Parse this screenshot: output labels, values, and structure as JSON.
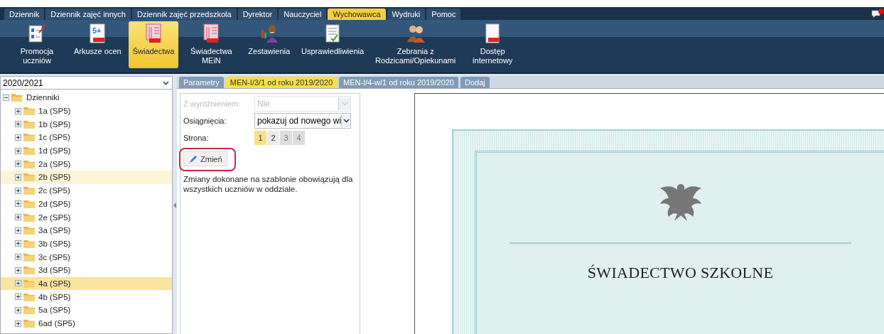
{
  "menu_tabs": [
    {
      "label": "Dziennik",
      "selected": false
    },
    {
      "label": "Dziennik zajęć innych",
      "selected": false
    },
    {
      "label": "Dziennik zajęć przedszkola",
      "selected": false
    },
    {
      "label": "Dyrektor",
      "selected": false
    },
    {
      "label": "Nauczyciel",
      "selected": false
    },
    {
      "label": "Wychowawca",
      "selected": true
    },
    {
      "label": "Wydruki",
      "selected": false
    },
    {
      "label": "Pomoc",
      "selected": false
    }
  ],
  "toolbar": [
    {
      "kind": "promotion",
      "label": "Promocja uczniów",
      "selected": false
    },
    {
      "kind": "pdf-grade",
      "label": "Arkusze ocen",
      "selected": false,
      "badge": "5+"
    },
    {
      "kind": "pdf-book",
      "label": "Świadectwa",
      "selected": true
    },
    {
      "kind": "pdf-book",
      "label": "Świadectwa MEiN",
      "selected": false
    },
    {
      "kind": "chart-person",
      "label": "Zestawienia",
      "selected": false
    },
    {
      "kind": "check-doc",
      "label": "Usprawiedliwienia",
      "selected": false
    },
    {
      "kind": "people",
      "label": "Zebrania z Rodzicami/Opiekunami",
      "selected": false
    },
    {
      "kind": "pdf-blank",
      "label": "Dostęp internetowy",
      "selected": false
    }
  ],
  "year_select": {
    "value": "2020/2021"
  },
  "tree": {
    "label": "Dzienniki",
    "expanded": true,
    "children": [
      {
        "label": "1a (SP5)",
        "selected": false,
        "hovered": false
      },
      {
        "label": "1b (SP5)",
        "selected": false,
        "hovered": false
      },
      {
        "label": "1c (SP5)",
        "selected": false,
        "hovered": false
      },
      {
        "label": "1d (SP5)",
        "selected": false,
        "hovered": false
      },
      {
        "label": "2a (SP5)",
        "selected": false,
        "hovered": false
      },
      {
        "label": "2b (SP5)",
        "selected": false,
        "hovered": true
      },
      {
        "label": "2c (SP5)",
        "selected": false,
        "hovered": false
      },
      {
        "label": "2d (SP5)",
        "selected": false,
        "hovered": false
      },
      {
        "label": "2e (SP5)",
        "selected": false,
        "hovered": false
      },
      {
        "label": "3a (SP5)",
        "selected": false,
        "hovered": false
      },
      {
        "label": "3b (SP5)",
        "selected": false,
        "hovered": false
      },
      {
        "label": "3c (SP5)",
        "selected": false,
        "hovered": false
      },
      {
        "label": "3d (SP5)",
        "selected": false,
        "hovered": false
      },
      {
        "label": "4a (SP5)",
        "selected": true,
        "hovered": false
      },
      {
        "label": "4b (SP5)",
        "selected": false,
        "hovered": false
      },
      {
        "label": "5a (SP5)",
        "selected": false,
        "hovered": false
      },
      {
        "label": "6ad (SP5)",
        "selected": false,
        "hovered": false
      }
    ]
  },
  "doc_tabs": [
    {
      "label": "Parametry",
      "selected": false
    },
    {
      "label": "MEN-I/3/1 od roku 2019/2020",
      "selected": true
    },
    {
      "label": "MEN-I/4-w/1 od roku 2019/2020",
      "selected": false
    },
    {
      "label": "Dodaj",
      "selected": false
    }
  ],
  "form": {
    "fields": [
      {
        "label": "Z wyróżnieniem:",
        "value": "Nie",
        "disabled": true
      },
      {
        "label": "Osiągnięcia:",
        "value": "pokazuj od nowego wi",
        "disabled": false
      }
    ],
    "pages_label": "Strona:",
    "pages": [
      {
        "label": "1",
        "selected": true,
        "disabled": false
      },
      {
        "label": "2",
        "selected": false,
        "disabled": false
      },
      {
        "label": "3",
        "selected": false,
        "disabled": true
      },
      {
        "label": "4",
        "selected": false,
        "disabled": true
      }
    ],
    "change_button": {
      "label": "Zmień",
      "outlined": true
    },
    "note": "Zmiany dokonane na szablonie obowiązują dla wszystkich uczniów w oddziale."
  },
  "document": {
    "title": "ŚWIADECTWO SZKOLNE"
  }
}
